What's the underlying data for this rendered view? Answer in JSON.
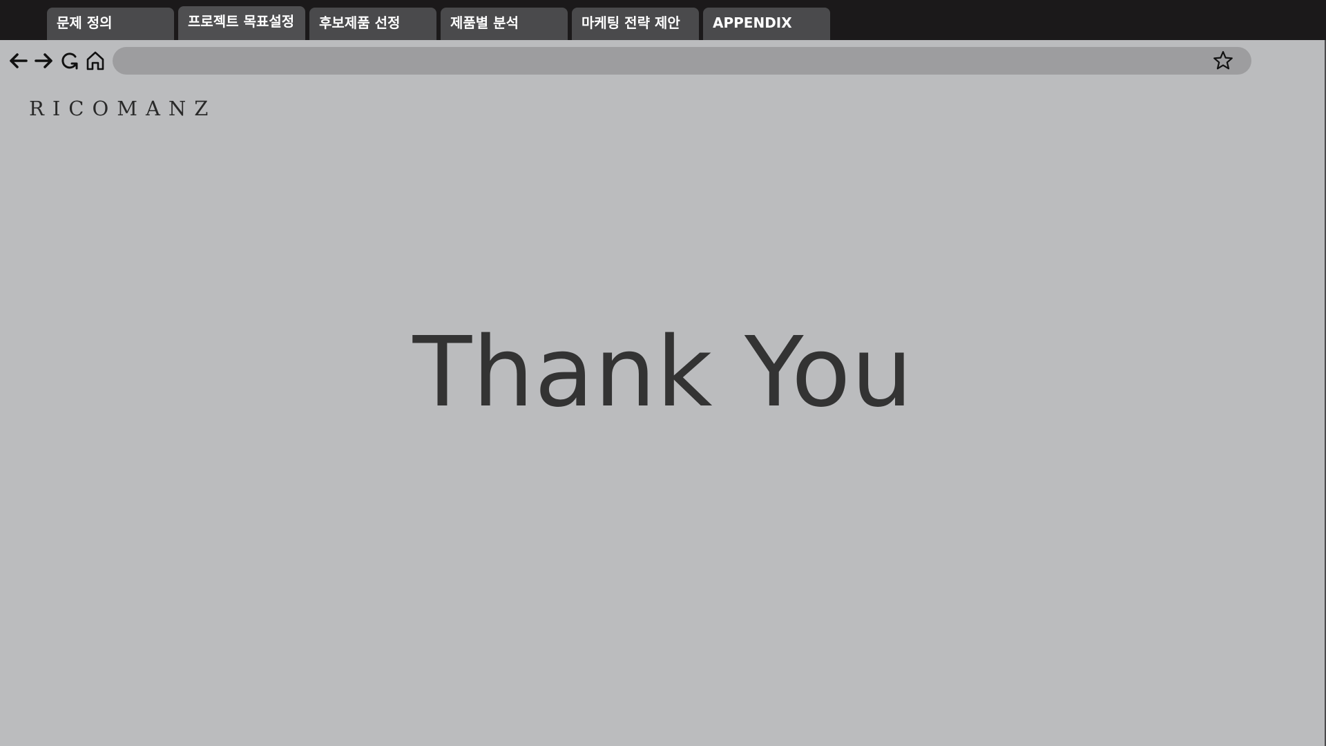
{
  "tabs": [
    {
      "label": "문제 정의"
    },
    {
      "label": "프로젝트 목표설정"
    },
    {
      "label": "후보제품 선정"
    },
    {
      "label": "제품별 분석"
    },
    {
      "label": "마케팅 전략 제안"
    },
    {
      "label": "APPENDIX"
    }
  ],
  "toolbar": {
    "back_icon": "arrow-left-icon",
    "forward_icon": "arrow-right-icon",
    "reload_icon": "reload-icon",
    "home_icon": "home-icon",
    "bookmark_icon": "star-icon",
    "url": ""
  },
  "logo": {
    "text": "RICOMANZ"
  },
  "main": {
    "headline": "Thank You"
  },
  "colors": {
    "tabbar_bg": "#1b191a",
    "tab_bg": "#4a4a4c",
    "page_bg": "#bbbcbe",
    "urlbar_bg": "#9d9d9f",
    "headline_color": "#333333"
  }
}
